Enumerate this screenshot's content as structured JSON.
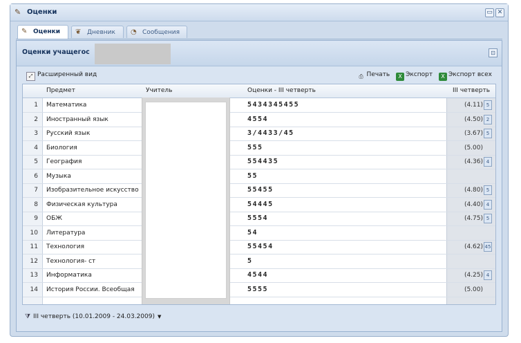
{
  "window": {
    "title": "Оценки"
  },
  "tabs": [
    {
      "label": "Оценки",
      "active": true
    },
    {
      "label": "Дневник",
      "active": false
    },
    {
      "label": "Сообщения",
      "active": false
    }
  ],
  "panel": {
    "title": "Оценки учащегос"
  },
  "toolbar": {
    "extended_view": "Расширенный вид",
    "print": "Печать",
    "export": "Экспорт",
    "export_all": "Экспорт всех"
  },
  "table": {
    "headers": [
      "Предмет",
      "Учитель",
      "Оценки - III четверть",
      "III четверть"
    ],
    "rows": [
      {
        "n": "1",
        "subject": "Математика",
        "grades": "5434345455",
        "avg": "(4.11)",
        "btn": "5"
      },
      {
        "n": "2",
        "subject": "Иностранный язык",
        "grades": "4554",
        "avg": "(4.50)",
        "btn": "2"
      },
      {
        "n": "3",
        "subject": "Русский язык",
        "grades": "3/4433/45",
        "avg": "(3.67)",
        "btn": "5"
      },
      {
        "n": "4",
        "subject": "Биология",
        "grades": "555",
        "avg": "(5.00)",
        "btn": ""
      },
      {
        "n": "5",
        "subject": "География",
        "grades": "554435",
        "avg": "(4.36)",
        "btn": "4"
      },
      {
        "n": "6",
        "subject": "Музыка",
        "grades": "55",
        "avg": "",
        "btn": ""
      },
      {
        "n": "7",
        "subject": "Изобразительное искусство",
        "grades": "55455",
        "avg": "(4.80)",
        "btn": "5"
      },
      {
        "n": "8",
        "subject": "Физическая культура",
        "grades": "54445",
        "avg": "(4.40)",
        "btn": "4"
      },
      {
        "n": "9",
        "subject": "ОБЖ",
        "grades": "5554",
        "avg": "(4.75)",
        "btn": "5"
      },
      {
        "n": "10",
        "subject": "Литература",
        "grades": "54",
        "avg": "",
        "btn": ""
      },
      {
        "n": "11",
        "subject": "Технология",
        "grades": "55454",
        "avg": "(4.62)",
        "btn": "45"
      },
      {
        "n": "12",
        "subject": "Технология- ст",
        "grades": "5",
        "avg": "",
        "btn": ""
      },
      {
        "n": "13",
        "subject": "Информатика",
        "grades": "4544",
        "avg": "(4.25)",
        "btn": "4"
      },
      {
        "n": "14",
        "subject": "История России. Всеобщая",
        "grades": "5555",
        "avg": "(5.00)",
        "btn": ""
      }
    ]
  },
  "footer": {
    "period_filter": "III четверть (10.01.2009 - 24.03.2009)"
  }
}
